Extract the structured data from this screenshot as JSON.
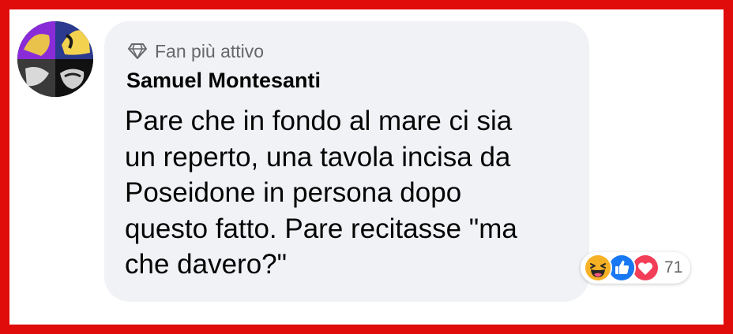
{
  "comment": {
    "badge_label": "Fan più attivo",
    "author": "Samuel Montesanti",
    "text_lines": [
      "Pare che in fondo al mare ci sia",
      "un reperto, una tavola incisa da",
      "Poseidone in persona dopo",
      "questo fatto. Pare recitasse \"ma",
      "che davero?\""
    ],
    "reactions": {
      "icons": [
        "haha-icon",
        "like-icon",
        "love-icon"
      ],
      "count": "71"
    }
  },
  "colors": {
    "frame": "#e00b0b",
    "bubble": "#f0f2f5",
    "secondary_text": "#65676b",
    "like_blue": "#1877f2",
    "love_red": "#f33e58",
    "haha_yellow": "#f7b125"
  }
}
